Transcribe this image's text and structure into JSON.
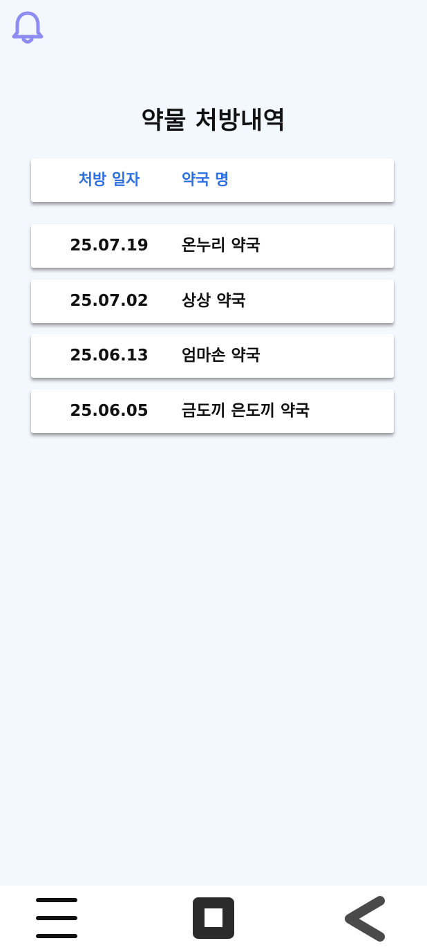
{
  "header": {
    "title": "약물 처방내역",
    "bell_icon": "bell-icon"
  },
  "table": {
    "columns": {
      "date": "처방 일자",
      "pharmacy": "약국 명"
    },
    "rows": [
      {
        "date": "25.07.19",
        "pharmacy": "온누리 약국"
      },
      {
        "date": "25.07.02",
        "pharmacy": "상상 약국"
      },
      {
        "date": "25.06.13",
        "pharmacy": "엄마손 약국"
      },
      {
        "date": "25.06.05",
        "pharmacy": "금도끼 은도끼 약국"
      }
    ]
  },
  "navbar": {
    "menu_icon": "menu-icon",
    "home_icon": "home-square-icon",
    "back_icon": "back-chevron-icon"
  },
  "colors": {
    "background": "#f3f7fe",
    "accent": "#2f6fe0",
    "bell": "#8c8cf2",
    "text": "#111111",
    "nav_icon": "#2b2b2b"
  }
}
